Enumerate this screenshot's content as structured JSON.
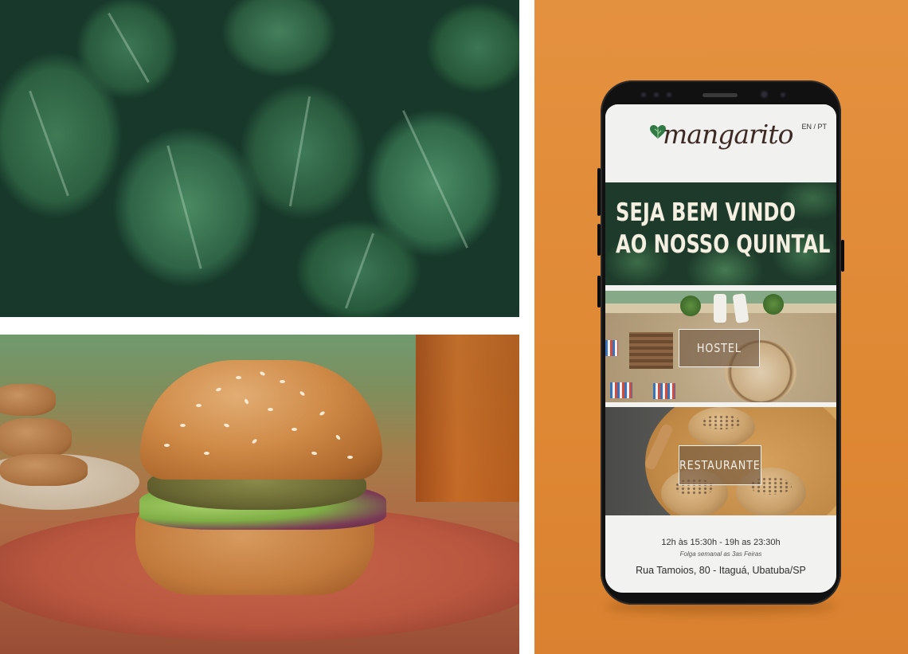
{
  "app": {
    "logo_text": "mangarito",
    "language_switch": "EN / PT"
  },
  "hero": {
    "line1": "SEJA BEM VINDO",
    "line2": "AO NOSSO QUINTAL"
  },
  "sections": {
    "hostel_label": "HOSTEL",
    "restaurant_label": "RESTAURANTE"
  },
  "footer": {
    "hours": "12h às 15:30h - 19h as 23:30h",
    "day_off": "Folga semanal as 3as Feiras",
    "address": "Rua Tamoios, 80 - Itaguá, Ubatuba/SP"
  },
  "colors": {
    "background_orange": "#e08a36",
    "leaf_green": "#2c5f40",
    "logo_brown": "#3d2a25",
    "heart_green": "#2f7a45"
  },
  "icons": {
    "logo_heart": "leaf-heart-icon"
  }
}
